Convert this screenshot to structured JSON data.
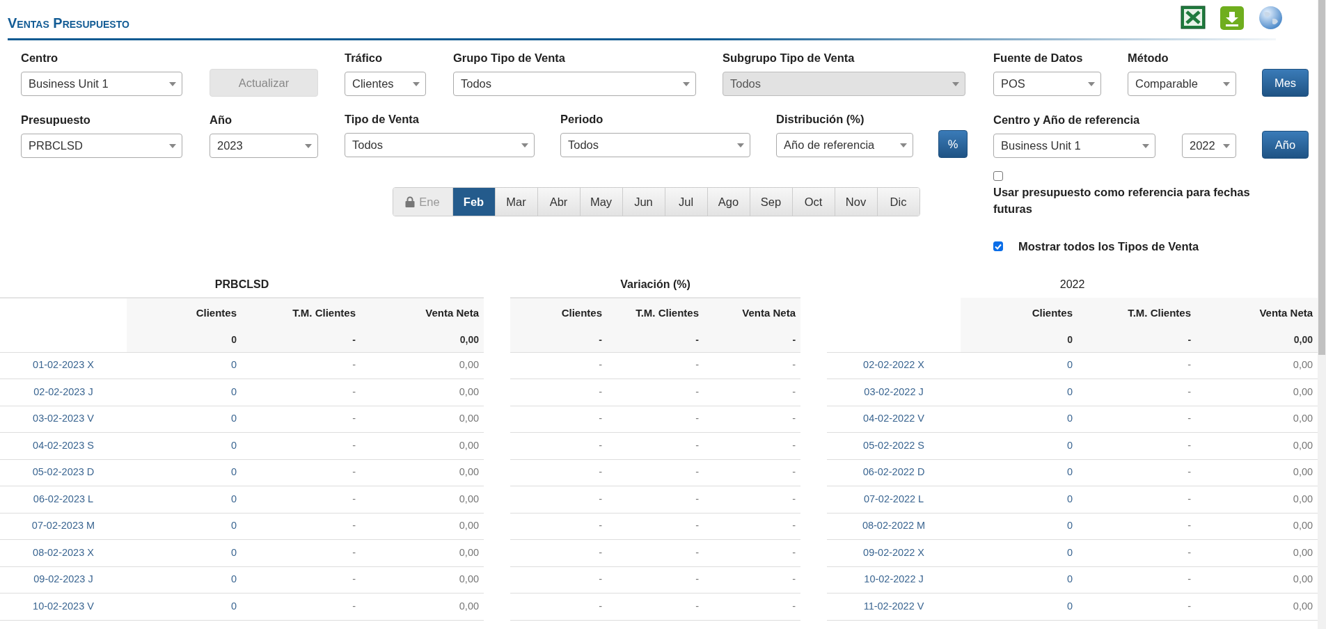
{
  "title": "Ventas Presupuesto",
  "filter_groups": [
    {
      "rows": [
        [
          {
            "kind": "select",
            "label": "Centro",
            "value": "Business Unit 1",
            "disabled": false
          },
          {
            "kind": "button",
            "label": "Actualizar",
            "disabled": true
          }
        ],
        [
          {
            "kind": "select",
            "label": "Presupuesto",
            "value": "PRBCLSD",
            "disabled": false
          },
          {
            "kind": "select",
            "label": "Año",
            "value": "2023",
            "disabled": false
          }
        ]
      ]
    },
    {
      "rows": [
        [
          {
            "kind": "select",
            "label": "Tráfico",
            "value": "Clientes",
            "disabled": false
          },
          {
            "kind": "select",
            "label": "Grupo Tipo de Venta",
            "value": "Todos",
            "disabled": false
          },
          {
            "kind": "select",
            "label": "Subgrupo Tipo de Venta",
            "value": "Todos",
            "disabled": true
          }
        ],
        [
          {
            "kind": "select",
            "label": "Tipo de Venta",
            "value": "Todos",
            "disabled": false
          },
          {
            "kind": "select",
            "label": "Periodo",
            "value": "Todos",
            "disabled": false
          },
          {
            "kind": "select",
            "label": "Distribución (%)",
            "value": "Año de referencia",
            "disabled": false
          },
          {
            "kind": "button",
            "label": "%",
            "disabled": false
          }
        ]
      ]
    },
    {
      "rows": [
        [
          {
            "kind": "select",
            "label": "Fuente de Datos",
            "value": "POS",
            "disabled": false
          },
          {
            "kind": "select",
            "label": "Método",
            "value": "Comparable",
            "disabled": false
          },
          {
            "kind": "button",
            "label": "Mes",
            "disabled": false
          }
        ],
        [
          {
            "kind": "select",
            "label": "Centro y Año de referencia",
            "value": "Business Unit 1",
            "disabled": false
          },
          {
            "kind": "select",
            "value": "2022",
            "disabled": false
          },
          {
            "kind": "button",
            "label": "Año",
            "disabled": false
          }
        ]
      ]
    }
  ],
  "months": [
    {
      "label": "Ene",
      "selected": false,
      "locked": true
    },
    {
      "label": "Feb",
      "selected": true,
      "locked": false
    },
    {
      "label": "Mar",
      "selected": false,
      "locked": false
    },
    {
      "label": "Abr",
      "selected": false,
      "locked": false
    },
    {
      "label": "May",
      "selected": false,
      "locked": false
    },
    {
      "label": "Jun",
      "selected": false,
      "locked": false
    },
    {
      "label": "Jul",
      "selected": false,
      "locked": false
    },
    {
      "label": "Ago",
      "selected": false,
      "locked": false
    },
    {
      "label": "Sep",
      "selected": false,
      "locked": false
    },
    {
      "label": "Oct",
      "selected": false,
      "locked": false
    },
    {
      "label": "Nov",
      "selected": false,
      "locked": false
    },
    {
      "label": "Dic",
      "selected": false,
      "locked": false
    }
  ],
  "options": [
    {
      "label": "Usar presupuesto como referencia para fechas futuras",
      "checked": false
    },
    {
      "label": "Mostrar todos los Tipos de Venta",
      "checked": true
    }
  ],
  "tables": [
    {
      "title": "PRBCLSD",
      "columns": [
        "Clientes",
        "T.M. Clientes",
        "Venta Neta"
      ],
      "totals": [
        "0",
        "-",
        "0,00"
      ],
      "rows": [
        {
          "date": "01-02-2023 X",
          "values": [
            "0",
            "-",
            "0,00"
          ]
        },
        {
          "date": "02-02-2023 J",
          "values": [
            "0",
            "-",
            "0,00"
          ]
        },
        {
          "date": "03-02-2023 V",
          "values": [
            "0",
            "-",
            "0,00"
          ]
        },
        {
          "date": "04-02-2023 S",
          "values": [
            "0",
            "-",
            "0,00"
          ]
        },
        {
          "date": "05-02-2023 D",
          "values": [
            "0",
            "-",
            "0,00"
          ]
        },
        {
          "date": "06-02-2023 L",
          "values": [
            "0",
            "-",
            "0,00"
          ]
        },
        {
          "date": "07-02-2023 M",
          "values": [
            "0",
            "-",
            "0,00"
          ]
        },
        {
          "date": "08-02-2023 X",
          "values": [
            "0",
            "-",
            "0,00"
          ]
        },
        {
          "date": "09-02-2023 J",
          "values": [
            "0",
            "-",
            "0,00"
          ]
        },
        {
          "date": "10-02-2023 V",
          "values": [
            "0",
            "-",
            "0,00"
          ]
        }
      ]
    },
    {
      "title": "Variación (%)",
      "columns": [
        "Clientes",
        "T.M. Clientes",
        "Venta Neta"
      ],
      "totals": [
        "-",
        "-",
        "-"
      ],
      "rows": [
        {
          "values": [
            "-",
            "-",
            "-"
          ]
        },
        {
          "values": [
            "-",
            "-",
            "-"
          ]
        },
        {
          "values": [
            "-",
            "-",
            "-"
          ]
        },
        {
          "values": [
            "-",
            "-",
            "-"
          ]
        },
        {
          "values": [
            "-",
            "-",
            "-"
          ]
        },
        {
          "values": [
            "-",
            "-",
            "-"
          ]
        },
        {
          "values": [
            "-",
            "-",
            "-"
          ]
        },
        {
          "values": [
            "-",
            "-",
            "-"
          ]
        },
        {
          "values": [
            "-",
            "-",
            "-"
          ]
        },
        {
          "values": [
            "-",
            "-",
            "-"
          ]
        }
      ]
    },
    {
      "title": "2022",
      "columns": [
        "Clientes",
        "T.M. Clientes",
        "Venta Neta"
      ],
      "totals": [
        "0",
        "-",
        "0,00"
      ],
      "rows": [
        {
          "date": "02-02-2022 X",
          "values": [
            "0",
            "-",
            "0,00"
          ]
        },
        {
          "date": "03-02-2022 J",
          "values": [
            "0",
            "-",
            "0,00"
          ]
        },
        {
          "date": "04-02-2022 V",
          "values": [
            "0",
            "-",
            "0,00"
          ]
        },
        {
          "date": "05-02-2022 S",
          "values": [
            "0",
            "-",
            "0,00"
          ]
        },
        {
          "date": "06-02-2022 D",
          "values": [
            "0",
            "-",
            "0,00"
          ]
        },
        {
          "date": "07-02-2022 L",
          "values": [
            "0",
            "-",
            "0,00"
          ]
        },
        {
          "date": "08-02-2022 M",
          "values": [
            "0",
            "-",
            "0,00"
          ]
        },
        {
          "date": "09-02-2022 X",
          "values": [
            "0",
            "-",
            "0,00"
          ]
        },
        {
          "date": "10-02-2022 J",
          "values": [
            "0",
            "-",
            "0,00"
          ]
        },
        {
          "date": "11-02-2022 V",
          "values": [
            "0",
            "-",
            "0,00"
          ]
        }
      ]
    }
  ]
}
